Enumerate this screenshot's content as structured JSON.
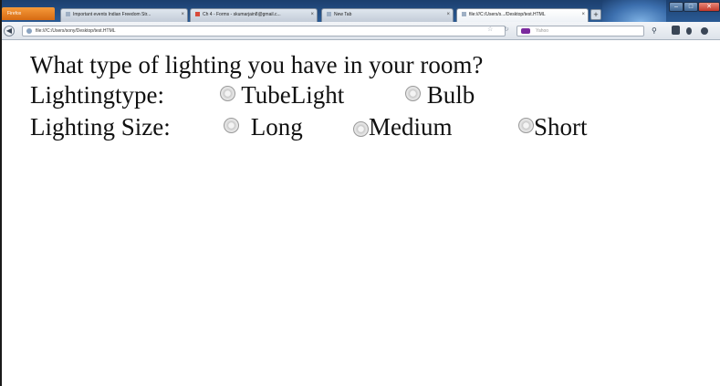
{
  "browser": {
    "app_menu_label": "Firefox",
    "tabs": [
      {
        "label": "Important events Indian Freedom Str...",
        "favicon": "page-icon"
      },
      {
        "label": "Ch 4 - Forms - skumarjain8@gmail.c...",
        "favicon": "gmail-icon"
      },
      {
        "label": "New Tab",
        "favicon": "page-icon"
      },
      {
        "label": "file:///C:/Users/s.../Desktop/test.HTML",
        "favicon": "page-icon",
        "active": true
      }
    ],
    "new_tab_symbol": "+",
    "url": "file:///C:/Users/sony/Desktop/test.HTML",
    "search_placeholder": "Yahoo",
    "star_symbol": "☆",
    "reload_symbol": "↻",
    "back_symbol": "◀",
    "search_symbol": "⚲",
    "window_buttons": {
      "minimize": "–",
      "maximize": "□",
      "close": "✕"
    }
  },
  "page": {
    "question": "What type of lighting you have in your room?",
    "lighting_type": {
      "label": "Lightingtype:",
      "options": [
        "TubeLight",
        "Bulb"
      ]
    },
    "lighting_size": {
      "label": "Lighting Size:",
      "options": [
        "Long",
        "Medium",
        "Short"
      ]
    }
  }
}
